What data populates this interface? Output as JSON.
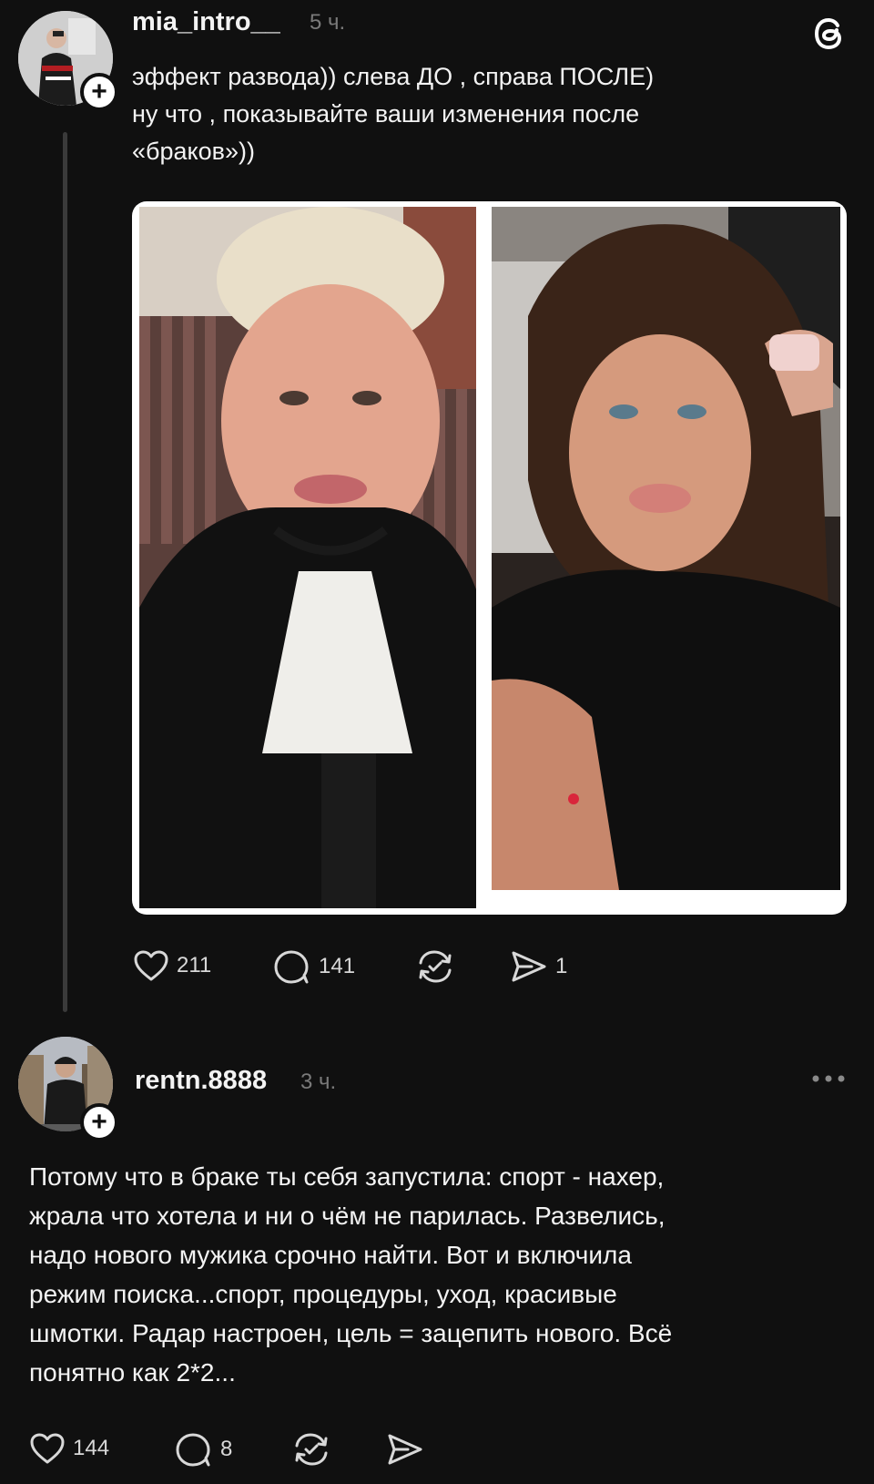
{
  "post": {
    "username": "mia_intro__",
    "time": "5 ч.",
    "text_lines": [
      "эффект развода)) слева ДО , справа ПОСЛЕ)",
      "ну что , показывайте ваши изменения после",
      "«браков»))"
    ],
    "likes": "211",
    "comments": "141",
    "shares": "1"
  },
  "reply": {
    "username": "rentn.8888",
    "time": "3 ч.",
    "text_lines": [
      "Потому что в браке ты себя запустила: спорт - нахер,",
      "жрала что хотела и ни о чём не парилась. Развелись,",
      "надо нового мужика срочно найти. Вот и включила",
      "режим поиска...спорт, процедуры, уход, красивые",
      "шмотки. Радар настроен, цель = зацепить нового. Всё",
      "понятно как 2*2..."
    ],
    "likes": "144",
    "comments": "8"
  },
  "icons": {
    "app_logo": "threads-logo-icon",
    "plus": "+",
    "more": "more-icon",
    "like": "heart-icon",
    "comment": "comment-icon",
    "repost": "repost-icon",
    "share": "share-icon"
  },
  "colors": {
    "background": "#101010",
    "text": "#f3f3f3",
    "muted": "#7a7a7a",
    "thread_line": "#3a3a3a"
  }
}
